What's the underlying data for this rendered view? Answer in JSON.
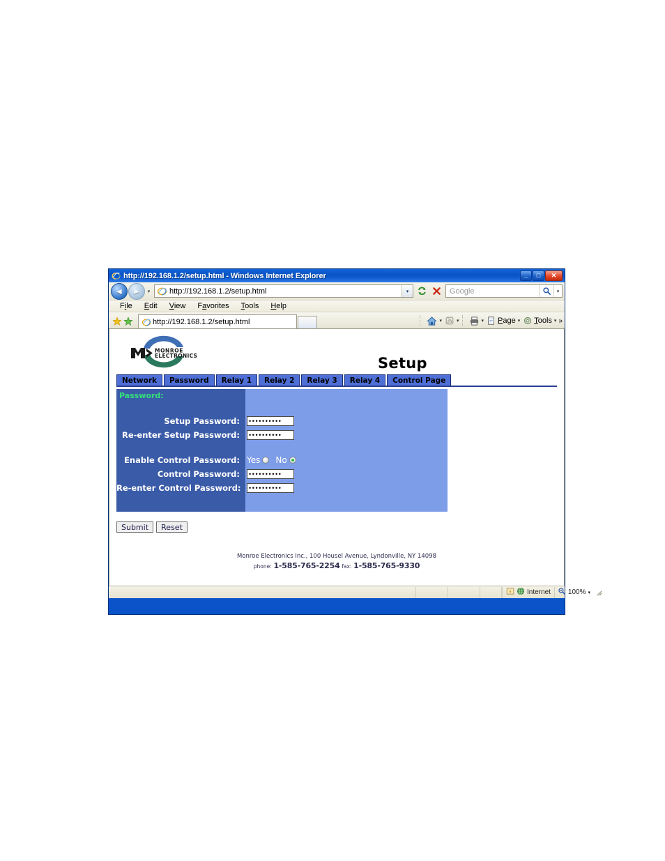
{
  "window": {
    "title": "http://192.168.1.2/setup.html - Windows Internet Explorer",
    "minimize_label": "_",
    "maximize_label": "□",
    "close_label": "✕"
  },
  "toolbar": {
    "back_icon": "back-arrow-icon",
    "forward_icon": "forward-arrow-icon",
    "history_caret": "▾",
    "address_value": "http://192.168.1.2/setup.html",
    "address_dropdown": "▾",
    "refresh_icon": "refresh-icon",
    "stop_icon": "stop-icon",
    "search_placeholder": "Google",
    "search_caret": "▾"
  },
  "menu": {
    "items": [
      {
        "pre": "F",
        "acc": "i",
        "post": "le"
      },
      {
        "pre": "",
        "acc": "E",
        "post": "dit"
      },
      {
        "pre": "",
        "acc": "V",
        "post": "iew"
      },
      {
        "pre": "F",
        "acc": "a",
        "post": "vorites"
      },
      {
        "pre": "",
        "acc": "T",
        "post": "ools"
      },
      {
        "pre": "",
        "acc": "H",
        "post": "elp"
      }
    ]
  },
  "tabbar": {
    "favorites_icon": "star-icon",
    "add-favorites_icon": "add-favorites-icon",
    "page_tab_label": "http://192.168.1.2/setup.html",
    "new_tab_label": "",
    "home_label": "",
    "feeds_label": "",
    "print_label": "",
    "page_pre": "",
    "page_acc": "P",
    "page_post": "age",
    "tools_pre": "",
    "tools_acc": "T",
    "tools_post": "ools",
    "overflow": "»",
    "caret": "▾"
  },
  "page": {
    "logo_line1": "MONROE",
    "logo_line2": "ELECTRONICS",
    "logo_mark": "ME>",
    "heading": "Setup",
    "nav_tabs": [
      {
        "label": "Network"
      },
      {
        "label": "Password"
      },
      {
        "label": "Relay 1"
      },
      {
        "label": "Relay 2"
      },
      {
        "label": "Relay 3"
      },
      {
        "label": "Relay 4"
      },
      {
        "label": "Control Page"
      }
    ],
    "panel_title": "Password:",
    "fields": [
      {
        "label": "Setup Password:",
        "value": "••••••••••",
        "type": "password"
      },
      {
        "label": "Re-enter Setup Password:",
        "value": "••••••••••",
        "type": "password"
      },
      {
        "label": "Enable Control Password:",
        "type": "radio",
        "yes_label": "Yes",
        "no_label": "No",
        "selected": "No"
      },
      {
        "label": "Control Password:",
        "value": "••••••••••",
        "type": "password"
      },
      {
        "label": "Re-enter Control Password:",
        "value": "••••••••••",
        "type": "password"
      }
    ],
    "submit_label": "Submit",
    "reset_label": "Reset",
    "footer_line1": "Monroe Electronics Inc., 100 Housel Avenue, Lyndonville, NY 14098",
    "footer_phone_label": "phone:",
    "footer_phone": "1-585-765-2254",
    "footer_fax_label": "fax:",
    "footer_fax": "1-585-765-9330"
  },
  "statusbar": {
    "zone_label": "Internet",
    "zone_icon": "internet-globe-icon",
    "security_icon": "security-icon",
    "zoom_label": "100%",
    "zoom_icon": "zoom-icon",
    "zoom_caret": "▾"
  },
  "colors": {
    "title_bar": "#0a54c4",
    "tab_blue": "#4e6fd6",
    "panel_left": "#3a5ba8",
    "panel_right": "#7e9de8",
    "panel_title_green": "#35e07a",
    "underline": "#2b3f91"
  }
}
